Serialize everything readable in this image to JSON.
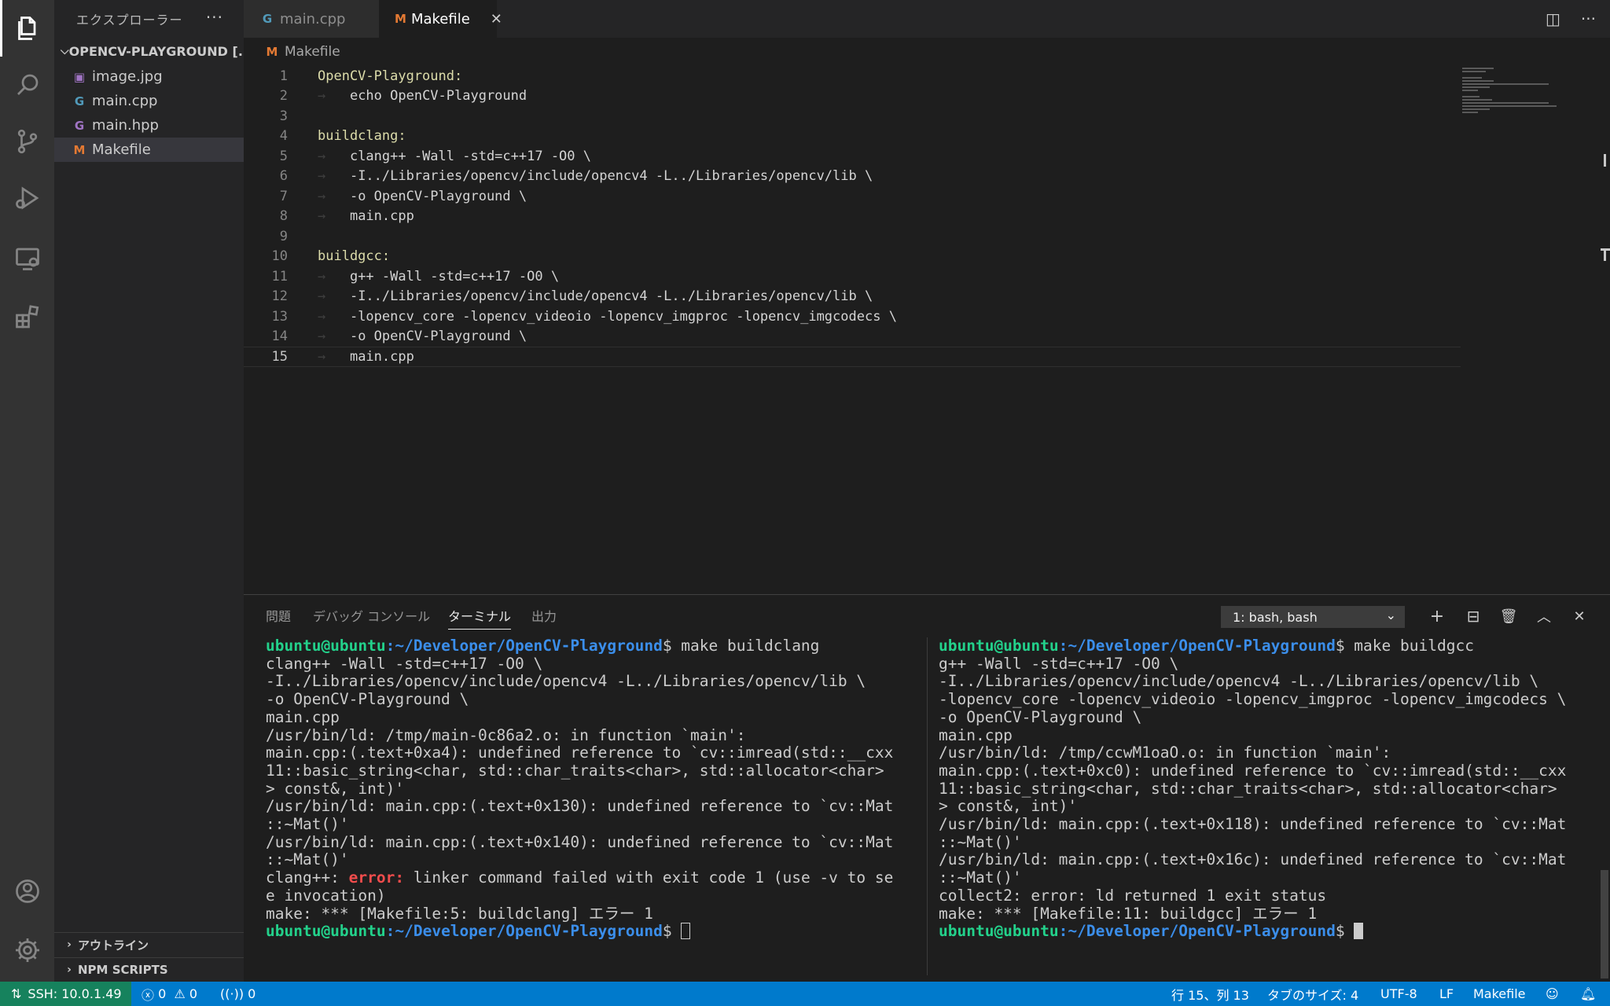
{
  "sidebar": {
    "title": "エクスプローラー",
    "more": "···",
    "folder": "OPENCV-PLAYGROUND [...",
    "files": [
      {
        "name": "image.jpg",
        "icon": "image-file-icon",
        "glyph": "▣"
      },
      {
        "name": "main.cpp",
        "icon": "cpp-file-icon",
        "glyph": "G"
      },
      {
        "name": "main.hpp",
        "icon": "hpp-file-icon",
        "glyph": "G"
      },
      {
        "name": "Makefile",
        "icon": "makefile-icon",
        "glyph": "M"
      }
    ],
    "outline": "アウトライン",
    "npm": "NPM SCRIPTS"
  },
  "tabs": [
    {
      "label": "main.cpp",
      "glyph": "G"
    },
    {
      "label": "Makefile",
      "glyph": "M",
      "close": "✕"
    }
  ],
  "breadcrumb": {
    "glyph": "M",
    "label": "Makefile"
  },
  "editor": {
    "lines": [
      {
        "n": "1",
        "target": "OpenCV-Playground:",
        "text": ""
      },
      {
        "n": "2",
        "target": "",
        "text": "echo OpenCV-Playground"
      },
      {
        "n": "3",
        "target": "",
        "text": ""
      },
      {
        "n": "4",
        "target": "buildclang:",
        "text": ""
      },
      {
        "n": "5",
        "target": "",
        "text": "clang++ -Wall -std=c++17 -O0 \\"
      },
      {
        "n": "6",
        "target": "",
        "text": "-I../Libraries/opencv/include/opencv4 -L../Libraries/opencv/lib \\"
      },
      {
        "n": "7",
        "target": "",
        "text": "-o OpenCV-Playground \\"
      },
      {
        "n": "8",
        "target": "",
        "text": "main.cpp"
      },
      {
        "n": "9",
        "target": "",
        "text": ""
      },
      {
        "n": "10",
        "target": "buildgcc:",
        "text": ""
      },
      {
        "n": "11",
        "target": "",
        "text": "g++ -Wall -std=c++17 -O0 \\"
      },
      {
        "n": "12",
        "target": "",
        "text": "-I../Libraries/opencv/include/opencv4 -L../Libraries/opencv/lib \\"
      },
      {
        "n": "13",
        "target": "",
        "text": "-lopencv_core -lopencv_videoio -lopencv_imgproc -lopencv_imgcodecs \\"
      },
      {
        "n": "14",
        "target": "",
        "text": "-o OpenCV-Playground \\"
      },
      {
        "n": "15",
        "target": "",
        "text": "main.cpp"
      }
    ],
    "current_line": "15"
  },
  "panel": {
    "tabs": [
      "問題",
      "デバッグ コンソール",
      "ターミナル",
      "出力"
    ],
    "active_tab": "ターミナル",
    "terminal_select": "1: bash, bash",
    "actions": {
      "add": "+",
      "split": "⊟",
      "trash": "🗑",
      "maximize": "︿",
      "close": "✕"
    }
  },
  "terminal_left": {
    "prompt_user": "ubuntu@ubuntu",
    "prompt_path": ":~/Developer/OpenCV-Playground",
    "command": "$ make buildclang",
    "output_lines": [
      "clang++ -Wall -std=c++17 -O0 \\",
      "-I../Libraries/opencv/include/opencv4 -L../Libraries/opencv/lib \\",
      "-o OpenCV-Playground \\",
      "main.cpp",
      "/usr/bin/ld: /tmp/main-0c86a2.o: in function `main':",
      "main.cpp:(.text+0xa4): undefined reference to `cv::imread(std::__cxx",
      "11::basic_string<char, std::char_traits<char>, std::allocator<char>",
      "> const&, int)'",
      "/usr/bin/ld: main.cpp:(.text+0x130): undefined reference to `cv::Mat",
      "::~Mat()'",
      "/usr/bin/ld: main.cpp:(.text+0x140): undefined reference to `cv::Mat",
      "::~Mat()'"
    ],
    "error_prefix": "clang++: ",
    "error_word": "error:",
    "error_rest": " linker command failed with exit code 1 (use -v to se",
    "error_cont": "e invocation)",
    "make_line": "make: *** [Makefile:5: buildclang] エラー 1",
    "final_prompt_end": "$ "
  },
  "terminal_right": {
    "prompt_user": "ubuntu@ubuntu",
    "prompt_path": ":~/Developer/OpenCV-Playground",
    "command": "$ make buildgcc",
    "output_lines": [
      "g++ -Wall -std=c++17 -O0 \\",
      "-I../Libraries/opencv/include/opencv4 -L../Libraries/opencv/lib \\",
      "-lopencv_core -lopencv_videoio -lopencv_imgproc -lopencv_imgcodecs \\",
      "-o OpenCV-Playground \\",
      "main.cpp",
      "/usr/bin/ld: /tmp/ccwM1oaO.o: in function `main':",
      "main.cpp:(.text+0xc0): undefined reference to `cv::imread(std::__cxx",
      "11::basic_string<char, std::char_traits<char>, std::allocator<char>",
      "> const&, int)'",
      "/usr/bin/ld: main.cpp:(.text+0x118): undefined reference to `cv::Mat",
      "::~Mat()'",
      "/usr/bin/ld: main.cpp:(.text+0x16c): undefined reference to `cv::Mat",
      "::~Mat()'",
      "collect2: error: ld returned 1 exit status",
      "make: *** [Makefile:11: buildgcc] エラー 1"
    ],
    "final_prompt_end": "$ "
  },
  "statusbar": {
    "remote": "SSH: 10.0.1.49",
    "errors": "0",
    "warnings": "0",
    "ports": "0",
    "position": "行 15、列 13",
    "tab_size": "タブのサイズ: 4",
    "encoding": "UTF-8",
    "eol": "LF",
    "language": "Makefile"
  },
  "colors": {
    "activity_bar": "#333333",
    "sidebar": "#252526",
    "editor": "#1e1e1e",
    "statusbar": "#007acc",
    "remote": "#16825d",
    "prompt_user": "#23d18b",
    "prompt_path": "#3b8eea",
    "error": "#f14c4c"
  }
}
